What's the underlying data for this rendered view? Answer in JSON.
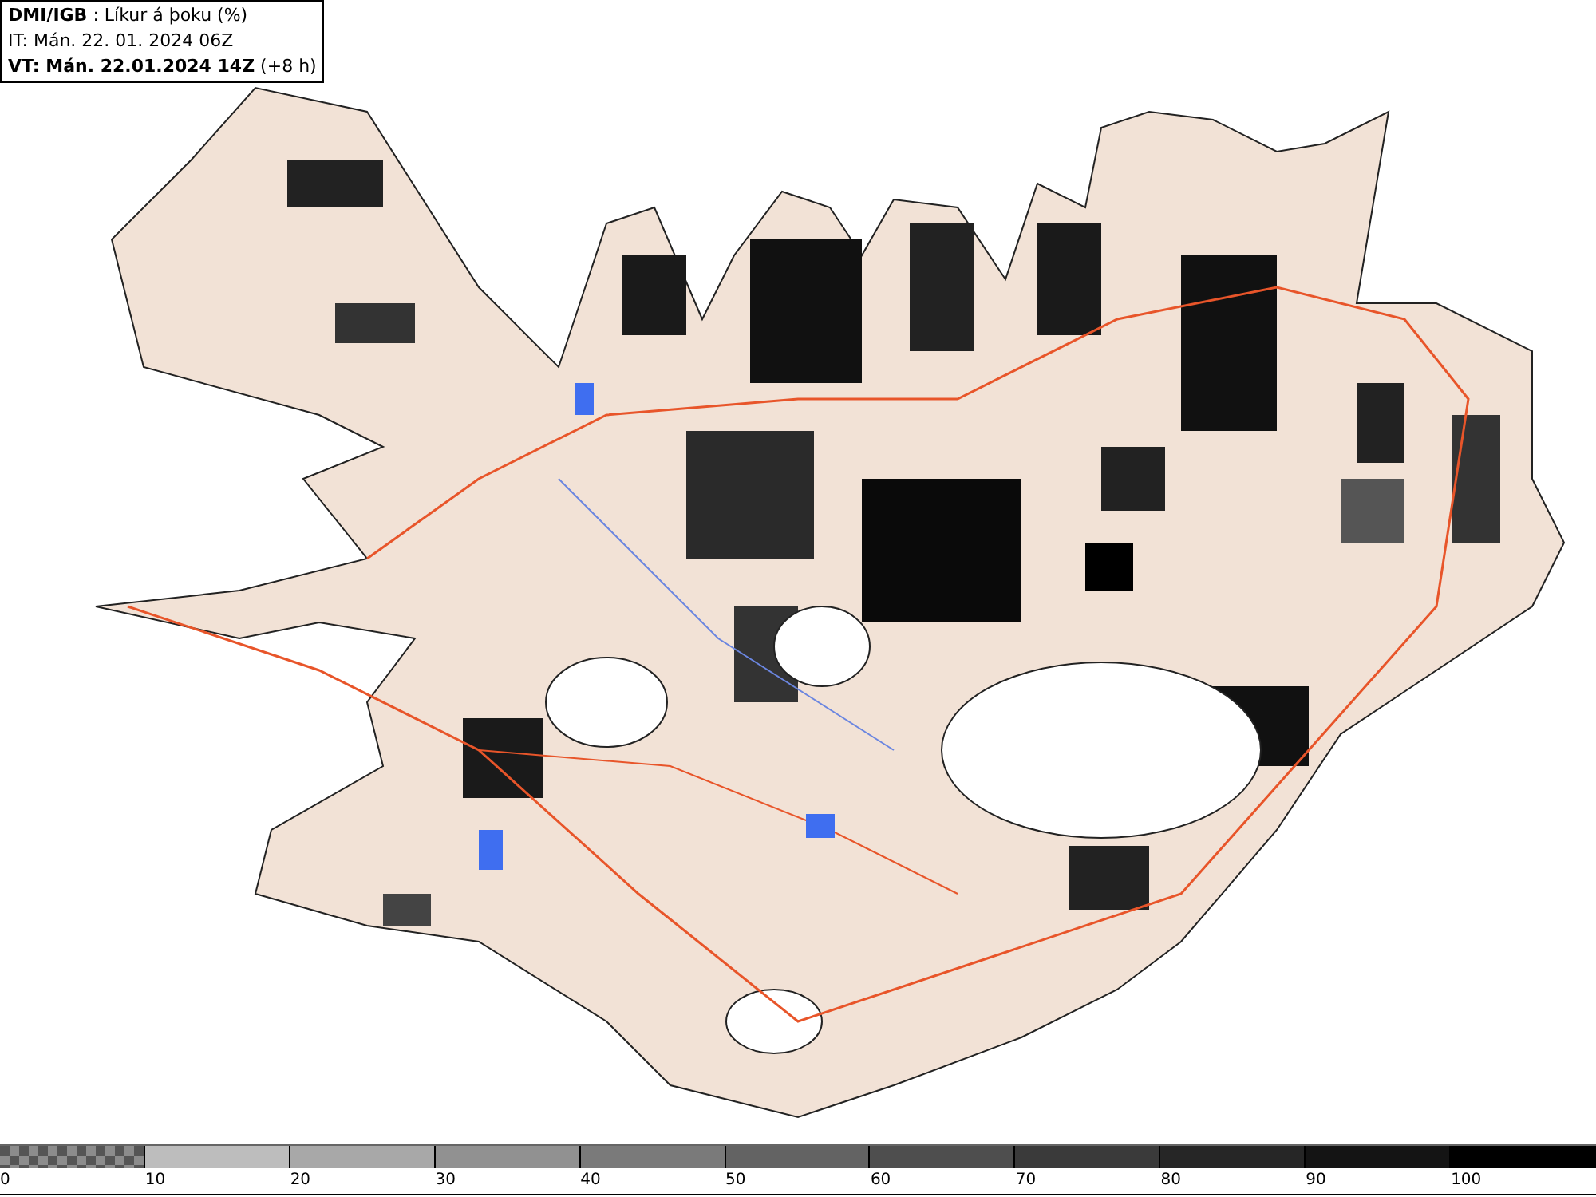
{
  "header": {
    "lines": [
      "**DMI/IGB** : Líkur á þoku (%)",
      "IT: Mán. 22. 01. 2024 06Z",
      "**VT: Mán. 22.01.2024 14Z** (+8 h)"
    ]
  },
  "legend": {
    "segments": [
      {
        "kind": "checker",
        "color": "#8c8c8c",
        "label": "0"
      },
      {
        "kind": "solid",
        "color": "#bdbdbd",
        "label": "10"
      },
      {
        "kind": "solid",
        "color": "#a8a8a8",
        "label": "20"
      },
      {
        "kind": "solid",
        "color": "#919191",
        "label": "30"
      },
      {
        "kind": "solid",
        "color": "#7a7a7a",
        "label": "40"
      },
      {
        "kind": "solid",
        "color": "#636363",
        "label": "50"
      },
      {
        "kind": "solid",
        "color": "#4e4e4e",
        "label": "60"
      },
      {
        "kind": "solid",
        "color": "#3a3a3a",
        "label": "70"
      },
      {
        "kind": "solid",
        "color": "#262626",
        "label": "80"
      },
      {
        "kind": "solid",
        "color": "#141414",
        "label": "90"
      },
      {
        "kind": "solid",
        "color": "#000000",
        "label": "100"
      }
    ]
  }
}
